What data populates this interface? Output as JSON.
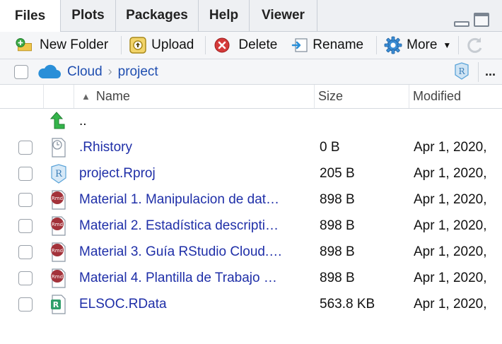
{
  "tabs": [
    {
      "label": "Files",
      "active": true
    },
    {
      "label": "Plots",
      "active": false
    },
    {
      "label": "Packages",
      "active": false
    },
    {
      "label": "Help",
      "active": false
    },
    {
      "label": "Viewer",
      "active": false
    }
  ],
  "toolbar": {
    "new_folder": "New Folder",
    "upload": "Upload",
    "delete": "Delete",
    "rename": "Rename",
    "more": "More"
  },
  "path": {
    "root": "Cloud",
    "folder": "project",
    "more": "..."
  },
  "columns": {
    "name": "Name",
    "size": "Size",
    "modified": "Modified"
  },
  "parent_link": "..",
  "files": [
    {
      "name": ".Rhistory",
      "size": "0 B",
      "modified": "Apr 1, 2020,",
      "icon": "history-file-icon"
    },
    {
      "name": "project.Rproj",
      "size": "205 B",
      "modified": "Apr 1, 2020,",
      "icon": "rproj-file-icon"
    },
    {
      "name": "Material 1. Manipulacion de dat…",
      "size": "898 B",
      "modified": "Apr 1, 2020,",
      "icon": "rmd-file-icon"
    },
    {
      "name": "Material 2. Estadística descripti…",
      "size": "898 B",
      "modified": "Apr 1, 2020,",
      "icon": "rmd-file-icon"
    },
    {
      "name": "Material 3. Guía RStudio Cloud.…",
      "size": "898 B",
      "modified": "Apr 1, 2020,",
      "icon": "rmd-file-icon"
    },
    {
      "name": "Material 4. Plantilla de Trabajo …",
      "size": "898 B",
      "modified": "Apr 1, 2020,",
      "icon": "rmd-file-icon"
    },
    {
      "name": "ELSOC.RData",
      "size": "563.8 KB",
      "modified": "Apr 1, 2020,",
      "icon": "rdata-file-icon"
    }
  ],
  "colors": {
    "link": "#1f2fa8",
    "rmd": "#a3323a",
    "rproj": "#5aa3d8",
    "rdata": "#2e9e6a",
    "cloud": "#2a8fd8"
  }
}
